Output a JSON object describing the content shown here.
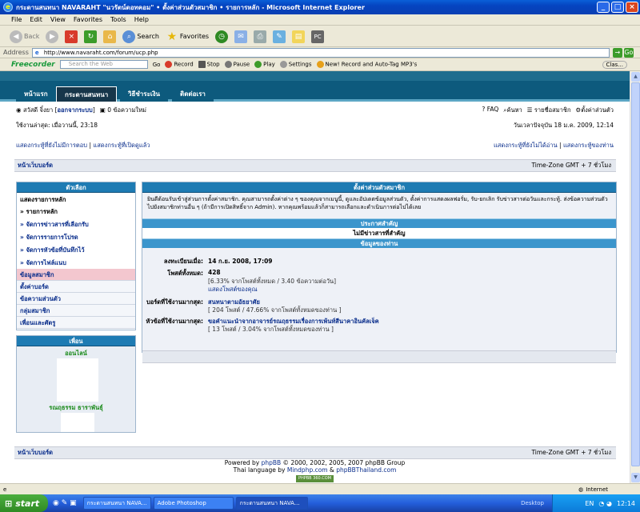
{
  "window": {
    "title": "กระดานสนทนา NAVARAHT \"นวรัตน์ดอทคอม\" • ตั้งค่าส่วนตัวสมาชิก • รายการหลัก - Microsoft Internet Explorer",
    "controls": {
      "min": "_",
      "max": "□",
      "close": "×"
    }
  },
  "menu": [
    "File",
    "Edit",
    "View",
    "Favorites",
    "Tools",
    "Help"
  ],
  "toolbar": {
    "back": "Back",
    "search": "Search",
    "favorites": "Favorites"
  },
  "address": {
    "label": "Address",
    "url": "http://www.navaraht.com/forum/ucp.php",
    "go": "Go"
  },
  "freecorder": {
    "logo": "Freecorder",
    "search_placeholder": "Search the Web",
    "go": "Go",
    "record": "Record",
    "stop": "Stop",
    "pause": "Pause",
    "play": "Play",
    "settings": "Settings",
    "promo": "New! Record and Auto-Tag MP3's",
    "clas": "Clas..."
  },
  "nav": {
    "tabs": [
      "หน้าแรก",
      "กระดานสนทนา",
      "วิธีชำระเงิน",
      "ติดต่อเรา"
    ]
  },
  "userbar": {
    "greeting_pre": "สวัสดี จิ๋งยา [",
    "logout": "ออกจากระบบ",
    "greeting_post": "]",
    "new_messages": "0 ข้อความใหม่",
    "faq": "FAQ",
    "search": "ค้นหา",
    "members": "รายชื่อสมาชิก",
    "ucp": "ตั้งค่าส่วนตัว",
    "last_visit": "ใช้งานล่าสุด: เมื่อวานนี้, 23:18",
    "current_time": "วันเวลาปัจจุบัน 18 ม.ค. 2009, 12:14"
  },
  "links": {
    "unanswered": "แสดงกระทู้ที่ยังไม่มีการตอบ",
    "active": "แสดงกระทู้ที่เปิดดูแล้ว",
    "unread": "แสดงกระทู้ที่ยังไม่ได้อ่าน",
    "own": "แสดงกระทู้ของท่าน",
    "sep": "|"
  },
  "crumb": {
    "index": "หน้าเว็บบอร์ด",
    "timezone": "Time-Zone GMT + 7 ชั่วโมง"
  },
  "sidebar": {
    "header": "ตัวเลือก",
    "section_title": "แสดงรายการหลัก",
    "items": [
      "» รายการหลัก",
      "» จัดการข่าวสารที่เลือกรับ",
      "» จัดการรายการโปรด",
      "» จัดการหัวข้อที่บันทึกไว้",
      "» จัดการไฟล์แนบ"
    ],
    "tabs": [
      "ข้อมูลสมาชิก",
      "ตั้งค่าบอร์ด",
      "ข้อความส่วนตัว",
      "กลุ่มสมาชิก",
      "เพื่อนและศัตรู"
    ],
    "friends_header": "เพื่อน",
    "online": "ออนไลน์",
    "friend_name": "รณฤธรรม ธาราพันธุ์"
  },
  "main": {
    "header": "ตั้งค่าส่วนตัวสมาชิก",
    "intro": "ยินดีต้อนรับเข้าสู่ส่วนการตั้งค่าสมาชิก. คุณสามารถตั้งค่าต่าง ๆ ของคุณจากเมนูนี้, ดูและอัปเดตข้อมูลส่วนตัว, ตั้งค่าการแสดงผลฟอรั่ม, รับ-ยกเลิก รับข่าวสารต่อวันและกระทู้. ส่งข้อความส่วนตัวไปยังสมาชิกท่านอื่น ๆ (ถ้ามีการเปิดสิทธิ์จาก Admin). หากคุณพร้อมแล้วก็สามารถเลือกและดำเนินการต่อไปได้เลย",
    "announcements_header": "ประกาศสำคัญ",
    "no_announcements": "ไม่มีข่าวสารที่สำคัญ",
    "yourinfo_header": "ข้อมูลของท่าน",
    "joined_label": "ลงทะเบียนเมื่อ:",
    "joined_value": "14 ก.ย. 2008, 17:09",
    "posts_label": "โพสต์ทั้งหมด:",
    "posts_value": "428",
    "posts_detail": "[6.33% จากโพสต์ทั้งหมด / 3.40 ข้อความต่อวัน]",
    "posts_link": "แสดงโพสต์ของคุณ",
    "active_forum_label": "บอร์ดที่ใช้งานมากสุด:",
    "active_forum_value": "สนทนาตามอัธยาศัย",
    "active_forum_detail": "[ 204 โพสต์ / 47.66% จากโพสต์ทั้งหมดของท่าน ]",
    "active_topic_label": "หัวข้อที่ใช้งานมากสุด:",
    "active_topic_value": "ขอคำแนะนำจากอาจารย์รณฤธรรมเรื่องการเพ้นท์สีนาคาอินคัลเจ็ค",
    "active_topic_detail": "[ 13 โพสต์ / 3.04% จากโพสต์ทั้งหมดของท่าน ]"
  },
  "footer": {
    "powered_pre": "Powered by ",
    "phpbb": "phpBB",
    "powered_post": " © 2000, 2002, 2005, 2007 phpBB Group",
    "thai_pre": "Thai language by ",
    "mindphp": "Mindphp.com",
    "thai_mid": " & ",
    "phpbbthai": "phpBBThailand.com",
    "badge": "PHPBB 360.COM"
  },
  "statusbar": {
    "zone": "Internet"
  },
  "taskbar": {
    "start": "start",
    "tasks": [
      "กระดานสนทนา NAVA...",
      "Adobe Photoshop",
      "กระดานสนทนา NAVA..."
    ],
    "desktop": "Desktop",
    "lang": "EN",
    "clock": "12:14"
  },
  "colors": {
    "nav_dark": "#0d5a7d",
    "panel_head": "#1e7bb3",
    "link": "#0a2e8c",
    "title_bar": "#0544c0"
  }
}
